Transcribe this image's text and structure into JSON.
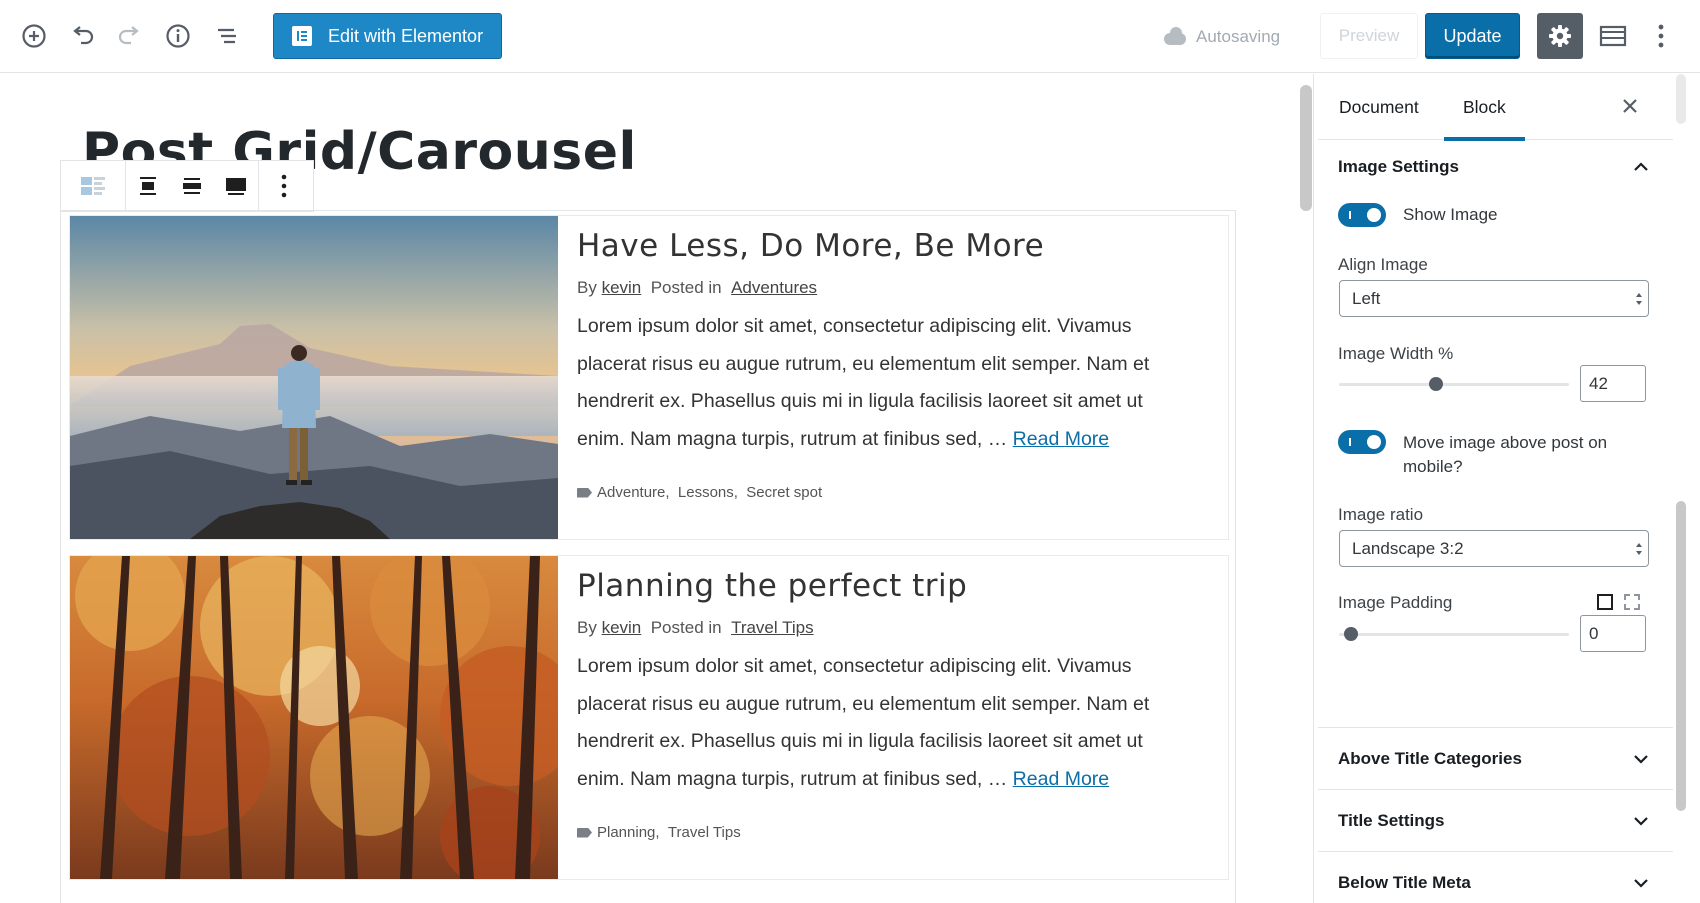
{
  "toolbar": {
    "elementor_label": "Edit with Elementor",
    "autosave_label": "Autosaving",
    "preview_label": "Preview",
    "update_label": "Update"
  },
  "editor": {
    "post_title": "Post Grid/Carousel",
    "posts": [
      {
        "title": "Have Less, Do More, Be More",
        "by": "By",
        "author": "kevin",
        "posted_in": "Posted in",
        "category": "Adventures",
        "excerpt": "Lorem ipsum dolor sit amet, consectetur adipiscing elit. Vivamus placerat risus eu augue rutrum, eu elementum elit semper. Nam et hendrerit ex. Phasellus quis mi in ligula facilisis laoreet sit amet ut enim. Nam magna turpis, rutrum at finibus sed, …",
        "read_more": "Read More",
        "tags": [
          "Adventure,",
          "Lessons,",
          "Secret spot"
        ]
      },
      {
        "title": "Planning the perfect trip",
        "by": "By",
        "author": "kevin",
        "posted_in": "Posted in",
        "category": "Travel Tips",
        "excerpt": "Lorem ipsum dolor sit amet, consectetur adipiscing elit. Vivamus placerat risus eu augue rutrum, eu elementum elit semper. Nam et hendrerit ex. Phasellus quis mi in ligula facilisis laoreet sit amet ut enim. Nam magna turpis, rutrum at finibus sed, …",
        "read_more": "Read More",
        "tags": [
          "Planning,",
          "Travel Tips"
        ]
      }
    ]
  },
  "sidebar": {
    "tabs": [
      {
        "label": "Document",
        "active": false
      },
      {
        "label": "Block",
        "active": true
      }
    ],
    "image_settings": {
      "title": "Image Settings",
      "show_image_label": "Show Image",
      "show_image_on": true,
      "align_image_label": "Align Image",
      "align_image_value": "Left",
      "image_width_label": "Image Width %",
      "image_width_value": "42",
      "move_image_label": "Move image above post on mobile?",
      "move_image_on": true,
      "image_ratio_label": "Image ratio",
      "image_ratio_value": "Landscape 3:2",
      "image_padding_label": "Image Padding",
      "image_padding_value": "0"
    },
    "sections": [
      "Above Title Categories",
      "Title Settings",
      "Below Title Meta"
    ]
  },
  "colors": {
    "accent": "#0a6ea8",
    "elementor": "#1e88c7",
    "gear_bg": "#555d66"
  }
}
